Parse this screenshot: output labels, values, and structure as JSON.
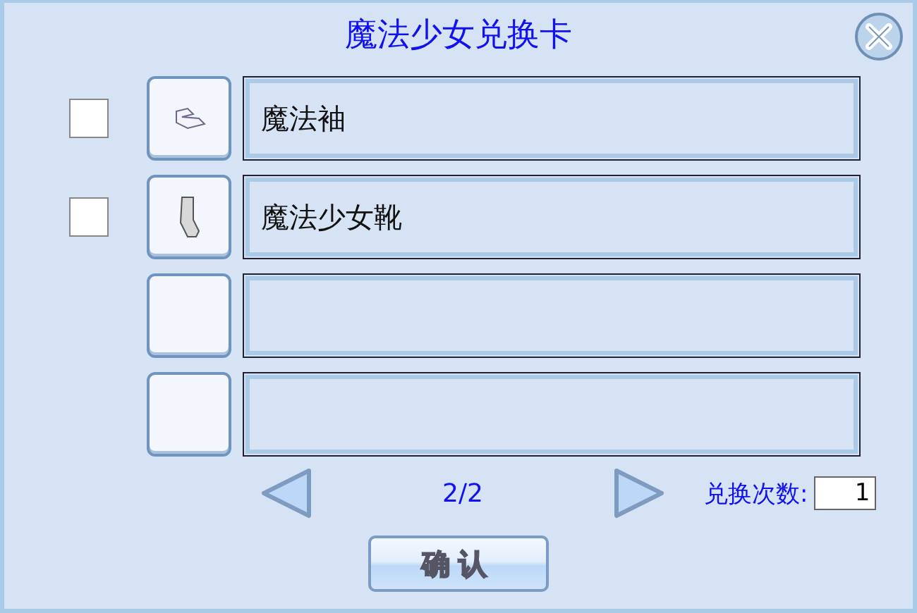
{
  "window": {
    "title": "魔法少女兑换卡"
  },
  "slots": [
    {
      "kind": "sleeve",
      "name": "魔法袖",
      "checked": false
    },
    {
      "kind": "boot",
      "name": "魔法少女靴",
      "checked": false
    },
    {
      "kind": "empty"
    },
    {
      "kind": "empty"
    }
  ],
  "pager": {
    "page": "2/2"
  },
  "count": {
    "label": "兑换次数:",
    "value": "1"
  },
  "confirm_button": "确认"
}
